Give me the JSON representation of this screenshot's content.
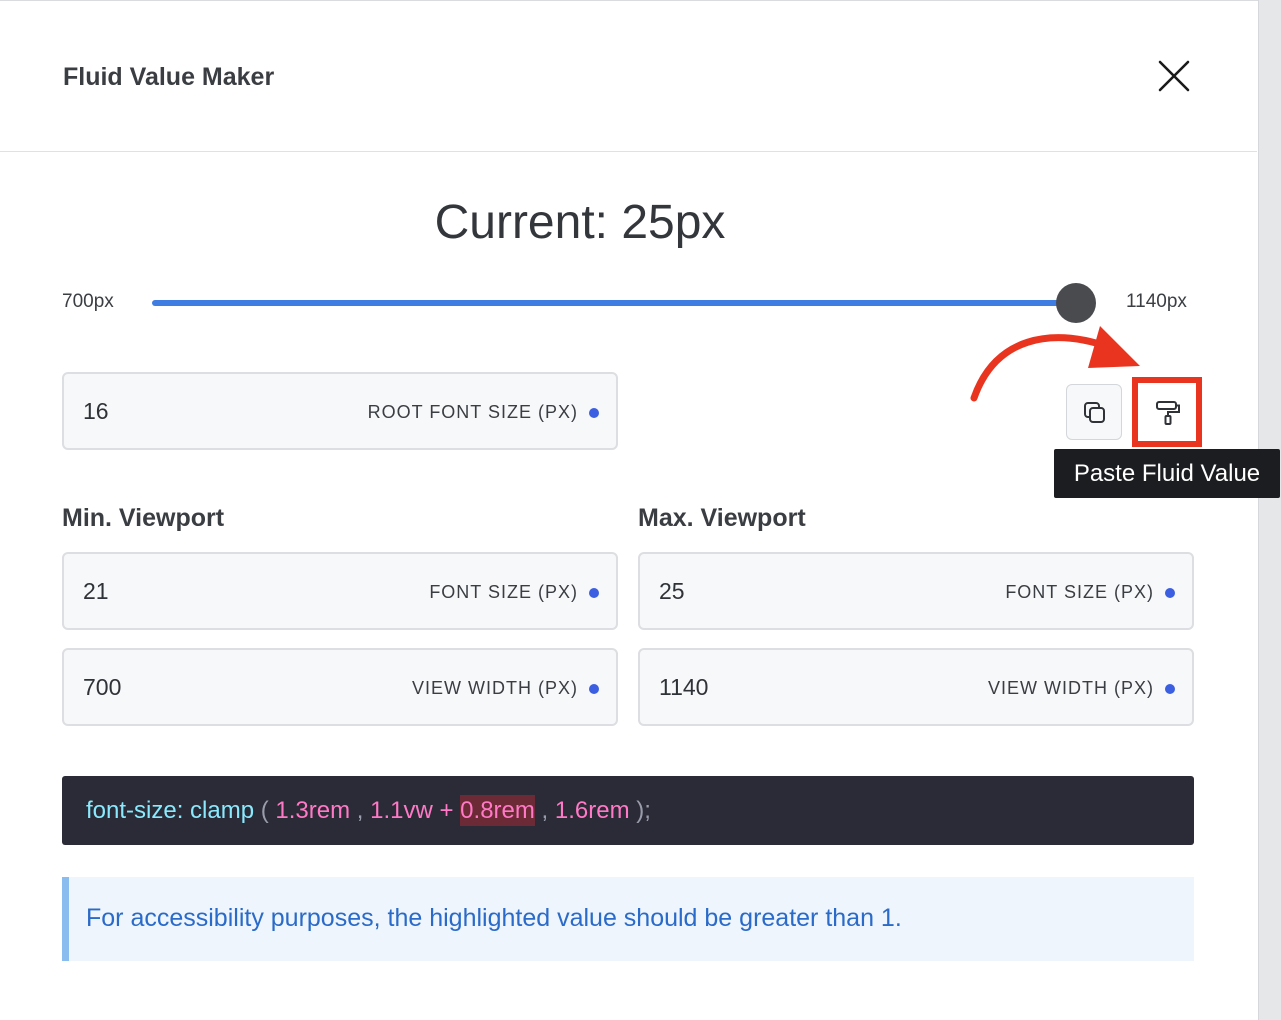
{
  "modal": {
    "title": "Fluid Value Maker",
    "close_icon": "close-icon"
  },
  "preview": {
    "current_text": "Current: 25px",
    "range_min": "700px",
    "range_max": "1140px",
    "slider_value_fraction": 1.0
  },
  "root_font": {
    "value": "16",
    "label": "ROOT FONT SIZE (PX)"
  },
  "toolbar": {
    "copy_icon": "copy-icon",
    "paste_icon": "paint-roller-icon",
    "paste_tooltip": "Paste Fluid Value"
  },
  "min_viewport": {
    "title": "Min. Viewport",
    "font_size": {
      "value": "21",
      "label": "FONT SIZE (PX)"
    },
    "view_width": {
      "value": "700",
      "label": "VIEW WIDTH (PX)"
    }
  },
  "max_viewport": {
    "title": "Max. Viewport",
    "font_size": {
      "value": "25",
      "label": "FONT SIZE (PX)"
    },
    "view_width": {
      "value": "1140",
      "label": "VIEW WIDTH (PX)"
    }
  },
  "output": {
    "property": "font-size: clamp",
    "open_paren": " ( ",
    "min": "1.3rem",
    "sep1": " , ",
    "preferred_vw": "1.1vw",
    "plus": " + ",
    "preferred_rem": "0.8rem",
    "sep2": " , ",
    "max": "1.6rem",
    "close": " );"
  },
  "notice": {
    "text": "For accessibility purposes, the highlighted value should be greater than 1."
  },
  "colors": {
    "accent": "#3f7de3",
    "annotation": "#e9351f",
    "code_bg": "#2a2b36"
  }
}
